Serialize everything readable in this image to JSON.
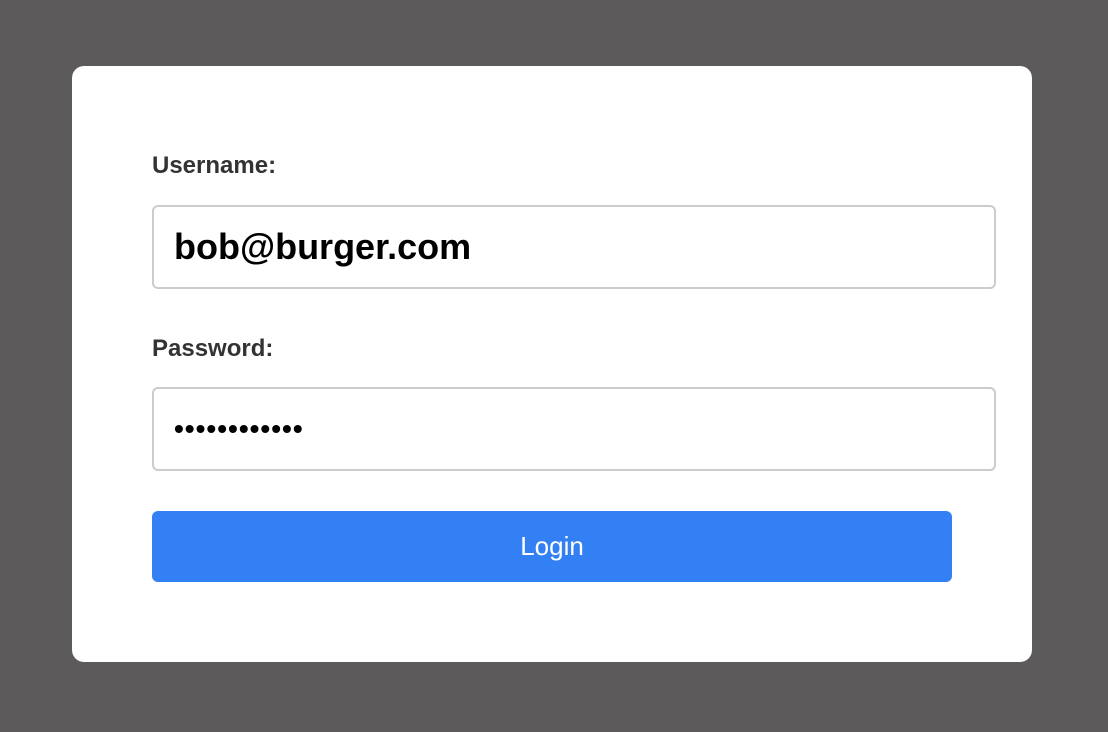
{
  "form": {
    "username": {
      "label": "Username:",
      "value": "bob@burger.com"
    },
    "password": {
      "label": "Password:",
      "value": "bobsburgers1"
    },
    "login_button": {
      "label": "Login"
    }
  },
  "colors": {
    "background": "#5c5a5b",
    "card": "#ffffff",
    "button": "#3380f5",
    "label_text": "#333333",
    "border": "#cccccc"
  }
}
